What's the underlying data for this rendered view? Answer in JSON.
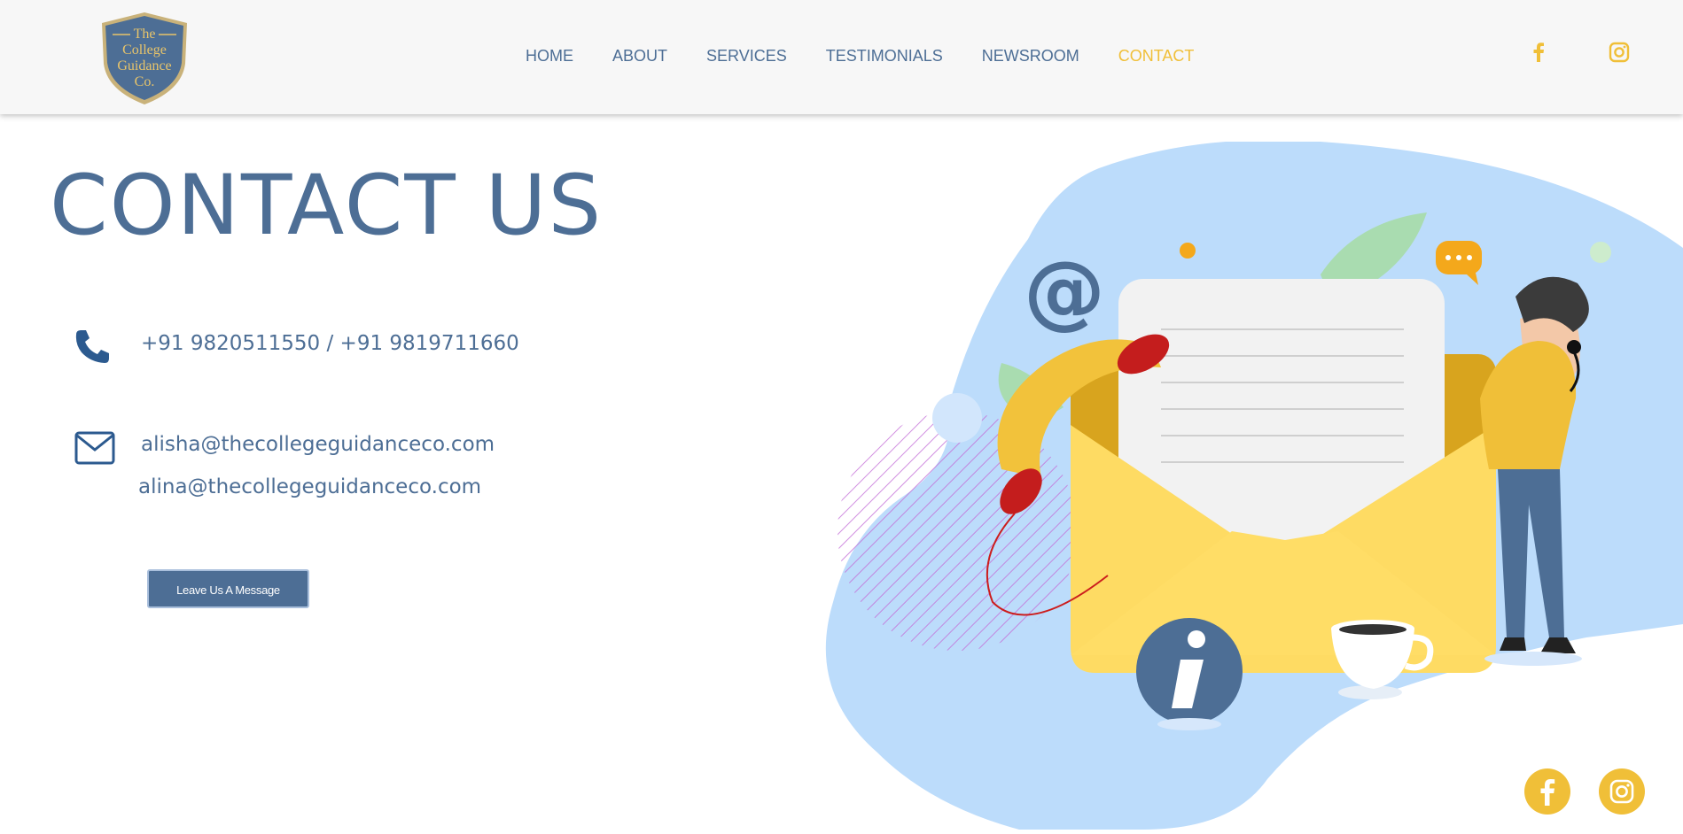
{
  "header": {
    "logo": {
      "line1": "The",
      "line2": "College",
      "line3": "Guidance",
      "line4": "Co."
    },
    "nav": [
      {
        "label": "HOME",
        "active": false
      },
      {
        "label": "ABOUT",
        "active": false
      },
      {
        "label": "SERVICES",
        "active": false
      },
      {
        "label": "TESTIMONIALS",
        "active": false
      },
      {
        "label": "NEWSROOM",
        "active": false
      },
      {
        "label": "CONTACT",
        "active": true
      }
    ],
    "social_icons": [
      "facebook-icon",
      "instagram-icon"
    ]
  },
  "main": {
    "title": "CONTACT US",
    "phone": "+91 9820511550 / +91 9819711660",
    "emails": [
      "alisha@thecollegeguidanceco.com",
      "alina@thecollegeguidanceco.com"
    ],
    "button_label": "Leave Us A Message"
  },
  "floating_social": [
    "facebook-icon",
    "instagram-icon"
  ],
  "colors": {
    "brand_blue": "#4d6e95",
    "accent_yellow": "#f0bf38",
    "illustration_bg": "#bcdcfb"
  }
}
